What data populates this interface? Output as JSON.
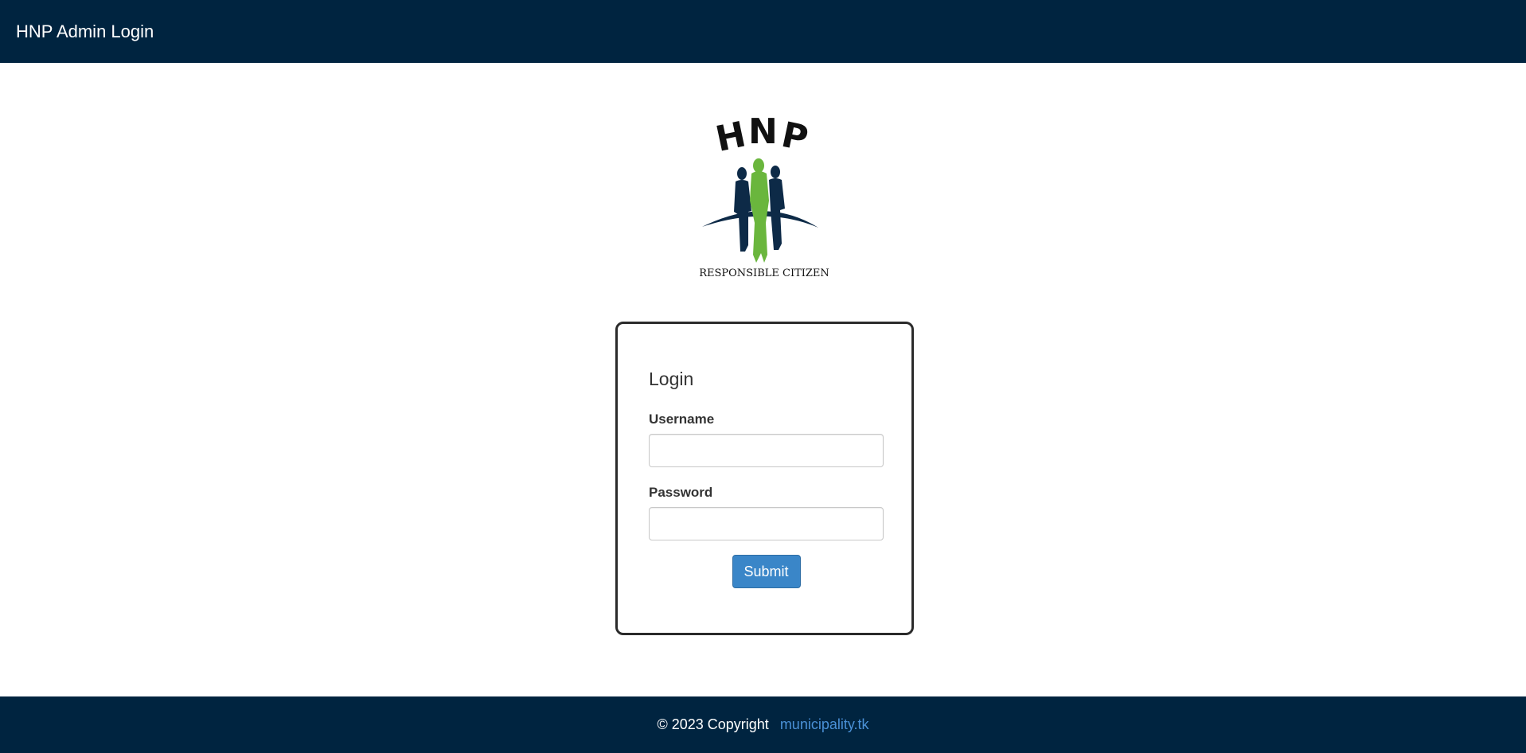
{
  "header": {
    "title": "HNP Admin Login"
  },
  "logo": {
    "top_text": "HNP",
    "tagline": "RESPONSIBLE CITIZEN",
    "colors": {
      "primary": "#0d2a47",
      "accent": "#6ab63d",
      "text": "#111111"
    }
  },
  "login": {
    "heading": "Login",
    "username_label": "Username",
    "username_value": "",
    "password_label": "Password",
    "password_value": "",
    "submit_label": "Submit"
  },
  "footer": {
    "copyright": "© 2023 Copyright",
    "link_text": "municipality.tk"
  },
  "colors": {
    "navbar_bg": "#002440",
    "button_bg": "#3a86c8",
    "link": "#4a90d6"
  }
}
